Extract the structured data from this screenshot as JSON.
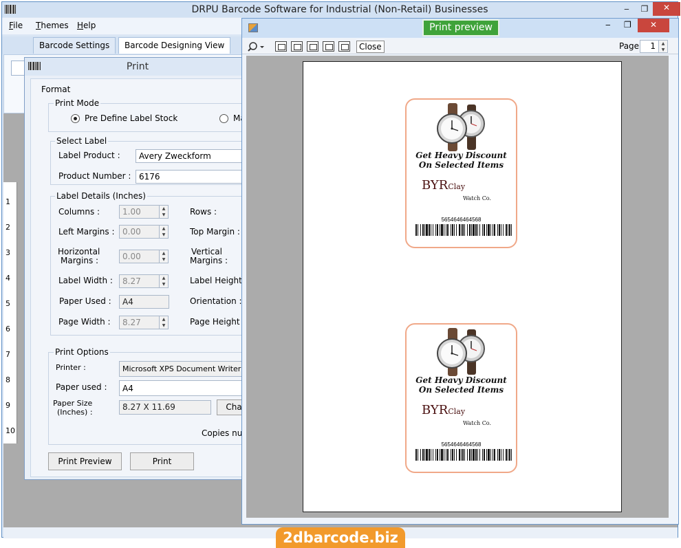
{
  "main": {
    "title": "DRPU Barcode Software for Industrial (Non-Retail) Businesses",
    "menu": [
      "File",
      "Themes",
      "Help"
    ],
    "menu_underline": [
      "F",
      "T",
      "H"
    ],
    "menu_rest": [
      "ile",
      "hemes",
      "elp"
    ],
    "tabs": [
      "Barcode Settings",
      "Barcode Designing View"
    ],
    "ruler_numbers": [
      "1",
      "2",
      "3",
      "4",
      "5",
      "6",
      "7",
      "8",
      "9",
      "10"
    ],
    "minimize": "‒",
    "maximize": "❐",
    "close": "✕"
  },
  "print_dialog": {
    "title": "Print",
    "format_label": "Format",
    "print_mode_label": "Print Mode",
    "print_mode_option1": "Pre Define Label Stock",
    "print_mode_option2": "Ma",
    "select_label_group": "Select Label",
    "label_product_label": "Label Product :",
    "label_product_value": "Avery Zweckform",
    "product_number_label": "Product Number :",
    "product_number_value": "6176",
    "label_details_group": "Label Details (Inches)",
    "columns_label": "Columns :",
    "columns_value": "1.00",
    "rows_label": "Rows :",
    "left_margins_label": "Left Margins :",
    "left_margins_value": "0.00",
    "top_margin_label": "Top Margin :",
    "horizontal_margins_label1": "Horizontal",
    "horizontal_margins_label2": "Margins :",
    "horizontal_margins_value": "0.00",
    "vertical_margins_label1": "Vertical",
    "vertical_margins_label2": "Margins :",
    "label_width_label": "Label Width :",
    "label_width_value": "8.27",
    "label_height_label": "Label Height :",
    "paper_used_label": "Paper Used :",
    "paper_used_value": "A4",
    "orientation_label": "Orientation :",
    "page_width_label": "Page Width :",
    "page_width_value": "8.27",
    "page_height_label": "Page Height :",
    "print_options_group": "Print Options",
    "printer_label": "Printer :",
    "printer_value": "Microsoft XPS Document Writer",
    "paper_used2_label": "Paper used :",
    "paper_used2_value": "A4",
    "paper_size_label1": "Paper Size",
    "paper_size_label2": "(Inches) :",
    "paper_size_value": "8.27 X 11.69",
    "change_button": "Cha",
    "copies_label": "Copies nur",
    "print_preview_button": "Print Preview",
    "print_button": "Print"
  },
  "preview": {
    "title": "Print preview",
    "close_button": "Close",
    "page_label": "Page",
    "page_value": "1",
    "labels": [
      {
        "promo_line1": "Get Heavy Discount",
        "promo_line2": "On Selected Items",
        "brand": "BYR",
        "brand_sub": "Clay",
        "company": "Watch Co.",
        "barcode_number": "5654646464568"
      },
      {
        "promo_line1": "Get Heavy Discount",
        "promo_line2": "On Selected Items",
        "brand": "BYR",
        "brand_sub": "Clay",
        "company": "Watch Co.",
        "barcode_number": "5654646464568"
      }
    ]
  },
  "watermark": "2dbarcode.biz",
  "colors": {
    "preview_title_badge": "#3fa33a",
    "close_red": "#c9463d",
    "label_border": "#f0a888",
    "watermark": "#f29a2c",
    "brand_text": "#4a1010"
  }
}
